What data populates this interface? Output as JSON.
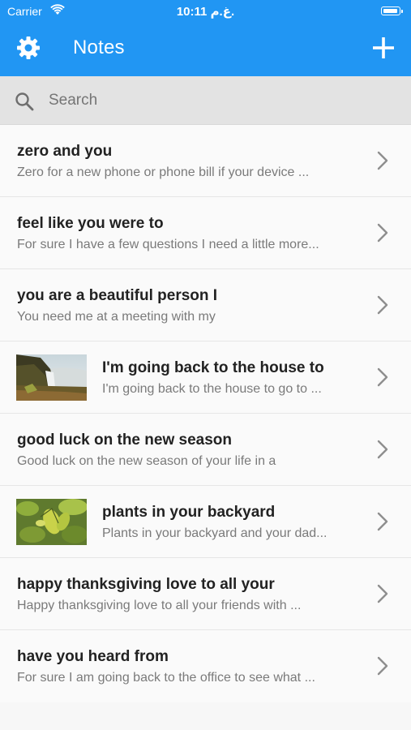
{
  "status_bar": {
    "carrier": "Carrier",
    "time": "10:11 غ.م."
  },
  "app_bar": {
    "title": "Notes",
    "settings_icon": "gear-icon",
    "add_icon": "plus-icon",
    "color": "#2196f3"
  },
  "search": {
    "placeholder": "Search",
    "icon": "search-icon"
  },
  "notes": [
    {
      "title": "zero and you",
      "preview": "Zero for a new phone or phone bill if your device ...",
      "image": ""
    },
    {
      "title": "feel like you were to",
      "preview": "For sure I have a few questions I need a little more...",
      "image": ""
    },
    {
      "title": "you are a beautiful person I",
      "preview": "You need me at a meeting with my",
      "image": ""
    },
    {
      "title": "I'm going back to the house to",
      "preview": "I'm going back to the house to go to ...",
      "image": "waterfall-landscape"
    },
    {
      "title": "good luck on the new season",
      "preview": "Good luck on the new season of your life in a",
      "image": ""
    },
    {
      "title": "plants in your backyard",
      "preview": "Plants in your backyard and your dad...",
      "image": "green-leaves"
    },
    {
      "title": "happy thanksgiving love to all your",
      "preview": "Happy thanksgiving love to all your friends with ...",
      "image": ""
    },
    {
      "title": "have you heard from",
      "preview": "For sure I am going back to the office to see what ...",
      "image": ""
    }
  ]
}
